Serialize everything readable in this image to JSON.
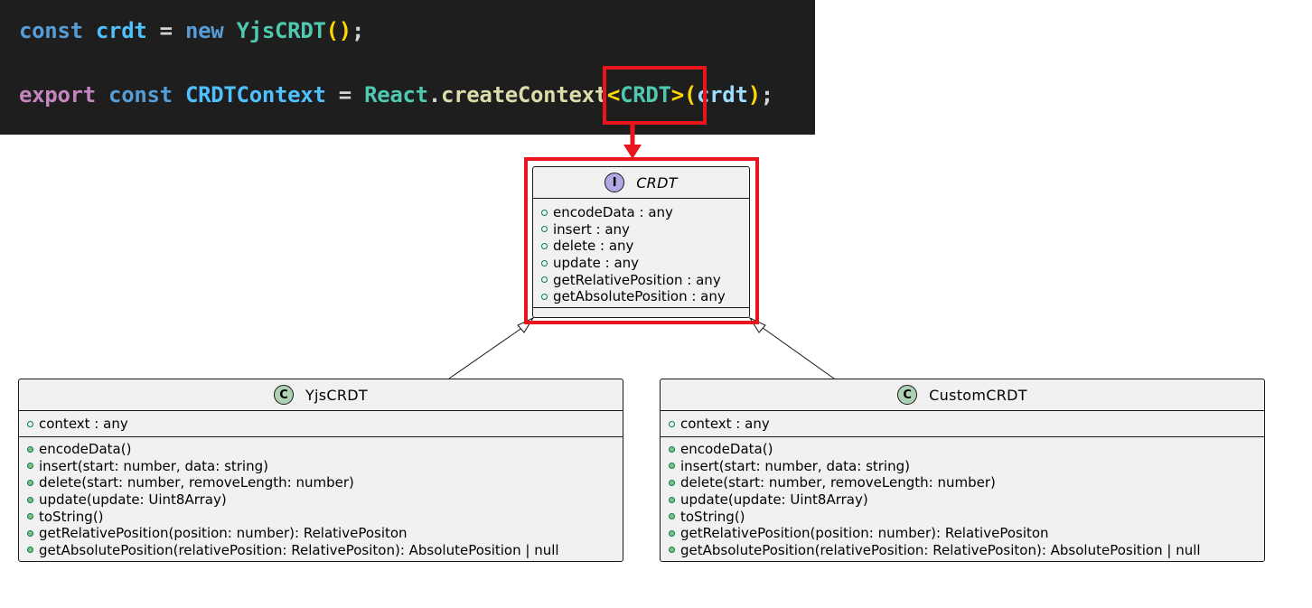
{
  "code": {
    "line1": [
      {
        "text": "const ",
        "color": "#569cd6"
      },
      {
        "text": "crdt",
        "color": "#4fc1ff"
      },
      {
        "text": " = ",
        "color": "#d4d4d4"
      },
      {
        "text": "new ",
        "color": "#569cd6"
      },
      {
        "text": "YjsCRDT",
        "color": "#4ec9b0"
      },
      {
        "text": "()",
        "color": "#ffd700"
      },
      {
        "text": ";",
        "color": "#d4d4d4"
      }
    ],
    "line2": [
      {
        "text": "export ",
        "color": "#c586c0"
      },
      {
        "text": "const ",
        "color": "#569cd6"
      },
      {
        "text": "CRDTContext",
        "color": "#4fc1ff"
      },
      {
        "text": " = ",
        "color": "#d4d4d4"
      },
      {
        "text": "React",
        "color": "#4ec9b0"
      },
      {
        "text": ".",
        "color": "#d4d4d4"
      },
      {
        "text": "createContext",
        "color": "#dcdcaa"
      },
      {
        "text": "<",
        "color": "#ffd700"
      },
      {
        "text": "CRDT",
        "color": "#4ec9b0"
      },
      {
        "text": ">",
        "color": "#ffd700"
      },
      {
        "text": "(",
        "color": "#ffd700"
      },
      {
        "text": "crdt",
        "color": "#9cdcfe"
      },
      {
        "text": ")",
        "color": "#ffd700"
      },
      {
        "text": ";",
        "color": "#d4d4d4"
      }
    ]
  },
  "interface_crdt": {
    "stereotype": "I",
    "name": "CRDT",
    "fields": [
      "encodeData : any",
      "insert : any",
      "delete : any",
      "update : any",
      "getRelativePosition : any",
      "getAbsolutePosition : any"
    ]
  },
  "class_yjs": {
    "stereotype": "C",
    "name": "YjsCRDT",
    "fields": [
      "context : any"
    ],
    "methods": [
      "encodeData()",
      "insert(start: number, data: string)",
      "delete(start: number, removeLength: number)",
      "update(update: Uint8Array)",
      "toString()",
      "getRelativePosition(position: number): RelativePositon",
      "getAbsolutePosition(relativePosition: RelativePositon): AbsolutePosition | null"
    ]
  },
  "class_custom": {
    "stereotype": "C",
    "name": "CustomCRDT",
    "fields": [
      "context : any"
    ],
    "methods": [
      "encodeData()",
      "insert(start: number, data: string)",
      "delete(start: number, removeLength: number)",
      "update(update: Uint8Array)",
      "toString()",
      "getRelativePosition(position: number): RelativePositon",
      "getAbsolutePosition(relativePosition: RelativePositon): AbsolutePosition | null"
    ]
  },
  "colors": {
    "highlight": "#e8161c",
    "code_background": "#1e1e1e",
    "box_fill": "#f1f1f1",
    "interface_badge": "#b4a7e5",
    "class_badge": "#add1b2"
  }
}
